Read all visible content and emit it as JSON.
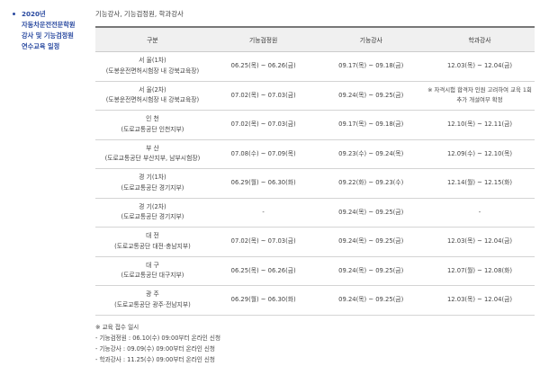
{
  "sidebar": {
    "items": [
      {
        "label": "2020년"
      },
      {
        "label": "자동차운전전문학원"
      },
      {
        "label": "강사 및 기능검정원"
      },
      {
        "label": "연수교육 일정"
      }
    ]
  },
  "main": {
    "subtitle": "기능강사, 기능검정원, 학과강사",
    "table": {
      "headers": [
        "구분",
        "기능검정원",
        "기능강사",
        "학과강사"
      ],
      "rows": [
        {
          "name": "서 울(1차)",
          "place": "(도봉운전면허시험장 내 강북교육장)",
          "inspector": "06.25(목) ~ 06.26(금)",
          "skill": "09.17(목) ~ 09.18(금)",
          "academic": "12.03(목) ~ 12.04(금)"
        },
        {
          "name": "서 울(2차)",
          "place": "(도봉운전면허시험장 내 강북교육장)",
          "inspector": "07.02(목) ~ 07.03(금)",
          "skill": "09.24(목) ~ 09.25(금)",
          "academic": "※ 자격시험 합격자 인원 고려하여 교육 1회 추가 개설여부 확정"
        },
        {
          "name": "인 천",
          "place": "(도로교통공단 인천지부)",
          "inspector": "07.02(목) ~ 07.03(금)",
          "skill": "09.17(목) ~ 09.18(금)",
          "academic": "12.10(목) ~ 12.11(금)"
        },
        {
          "name": "부 산",
          "place": "(도로교통공단 부산지부, 남부시험장)",
          "inspector": "07.08(수) ~ 07.09(목)",
          "skill": "09.23(수) ~ 09.24(목)",
          "academic": "12.09(수) ~ 12.10(목)"
        },
        {
          "name": "경 기(1차)",
          "place": "(도로교통공단 경기지부)",
          "inspector": "06.29(월) ~ 06.30(화)",
          "skill": "09.22(화) ~ 09.23(수)",
          "academic": "12.14(월) ~ 12.15(화)"
        },
        {
          "name": "경 기(2차)",
          "place": "(도로교통공단 경기지부)",
          "inspector": "-",
          "skill": "09.24(목) ~ 09.25(금)",
          "academic": "-"
        },
        {
          "name": "대 전",
          "place": "(도로교통공단 대전·충남지부)",
          "inspector": "07.02(목) ~ 07.03(금)",
          "skill": "09.24(목) ~ 09.25(금)",
          "academic": "12.03(목) ~ 12.04(금)"
        },
        {
          "name": "대 구",
          "place": "(도로교통공단 대구지부)",
          "inspector": "06.25(목) ~ 06.26(금)",
          "skill": "09.24(목) ~ 09.25(금)",
          "academic": "12.07(월) ~ 12.08(화)"
        },
        {
          "name": "광 주",
          "place": "(도로교통공단 광주·전남지부)",
          "inspector": "06.29(월) ~ 06.30(화)",
          "skill": "09.24(목) ~ 09.25(금)",
          "academic": "12.03(목) ~ 12.04(금)"
        }
      ]
    },
    "notes": {
      "title": "※ 교육 접수 일시",
      "items": [
        "- 기능검정원 : 06.10(수) 09:00부터 온라인 신청",
        "- 기능강사 : 09.09(수) 09:00부터 온라인 신청",
        "- 학과강사 : 11.25(수) 09:00부터 온라인 신청"
      ]
    }
  }
}
